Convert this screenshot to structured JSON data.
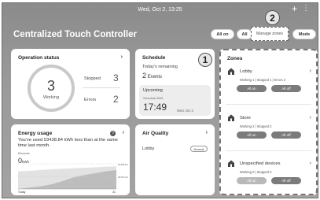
{
  "status_bar": {
    "datetime": "Wed, Oct 2, 13:25"
  },
  "header": {
    "title": "Centralized Touch Controller",
    "all_on": "All on",
    "all_off": "All",
    "mode": "Mode",
    "manage_zones": "Manage zones"
  },
  "badges": {
    "one": "1",
    "two": "2"
  },
  "operation_status": {
    "title": "Operation status",
    "working_count": "3",
    "working_label": "Working",
    "stopped_label": "Stopped",
    "stopped_count": "3",
    "errors_label": "Errors",
    "errors_count": "2"
  },
  "schedule": {
    "title": "Schedule",
    "remaining_label": "Today's remaining",
    "events_count": "2",
    "events_label": "Events",
    "upcoming_label": "Upcoming",
    "schedule_name": "Schedule 0025",
    "time": "17:49",
    "date": "Wed, Oct 2"
  },
  "energy": {
    "title": "Energy usage",
    "message": "You've used 53438.84 kWh less than at the same time last month.",
    "legend": "Elements",
    "current": "0",
    "unit": "kWh",
    "y_label_top": "53438.84",
    "y_label_mid": "26719.42",
    "x_start": "Today",
    "x_end": "31"
  },
  "chart_data": {
    "type": "area",
    "series": [
      {
        "values": [
          0,
          0.05,
          0.1,
          0.18,
          0.3,
          0.45,
          0.55,
          0.62,
          0.7,
          0.75
        ]
      },
      {
        "values": [
          0.7,
          0.72,
          0.75,
          0.78,
          0.8,
          0.82,
          0.84,
          0.86,
          0.88,
          0.9
        ]
      }
    ]
  },
  "air_quality": {
    "title": "Air Quality",
    "location": "Lobby",
    "status": "Normal"
  },
  "zones": {
    "title": "Zones",
    "items": [
      {
        "name": "Lobby",
        "stats": "Working 1 | Stopped 1 | Errors 2",
        "on": "All on",
        "off": "All off"
      },
      {
        "name": "Store",
        "stats": "Working 2 | Stopped 2",
        "on": "All on",
        "off": "All off"
      },
      {
        "name": "Unspecified devices",
        "stats": "Working 0 | Stopped 3",
        "on": "All on",
        "off": "All off"
      }
    ]
  },
  "colors": {
    "background": "#9a9a9a",
    "card": "#ffffff",
    "button": "#7b7b7b"
  }
}
